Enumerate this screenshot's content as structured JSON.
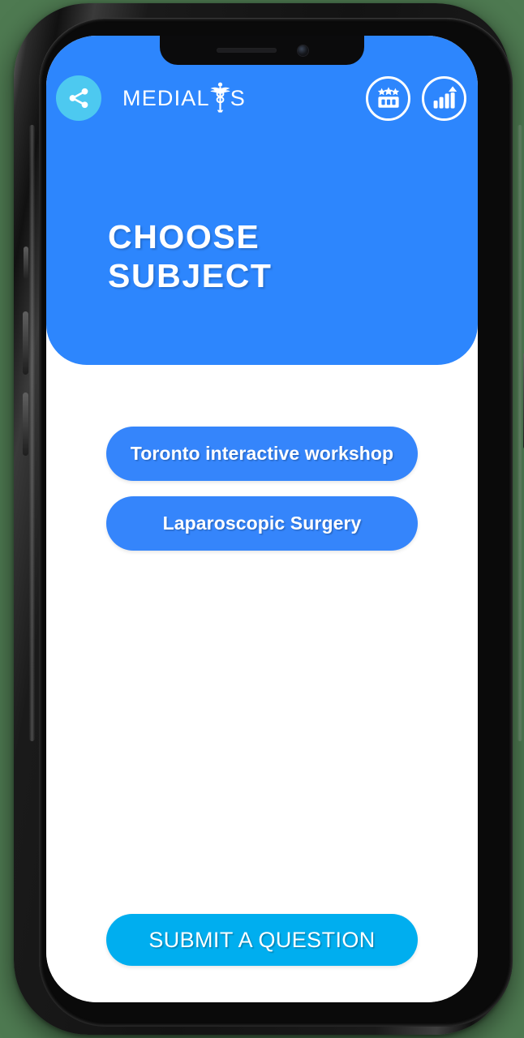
{
  "device": {
    "type": "smartphone-mockup",
    "background_color": "#4e7a51"
  },
  "theme": {
    "header_blue": "#2d86fd",
    "subject_button_blue": "#3585fb",
    "submit_cyan": "#00aeef",
    "share_circle_cyan": "#4dc9f0",
    "text_white": "#ffffff"
  },
  "header": {
    "share_button": {
      "icon": "share-icon",
      "label": "Share"
    },
    "brand": {
      "text_before": "MEDIAL",
      "symbol": "caduceus-icon",
      "text_after": "S",
      "full_name": "MEDIALIS"
    },
    "actions": [
      {
        "name": "leaderboard-button",
        "icon": "leaderboard-icon",
        "label": "Leaderboard"
      },
      {
        "name": "statistics-button",
        "icon": "growth-chart-icon",
        "label": "Statistics"
      }
    ],
    "title": "CHOOSE\nSUBJECT"
  },
  "main": {
    "subjects": [
      {
        "label": "Toronto interactive workshop"
      },
      {
        "label": "Laparoscopic Surgery"
      }
    ]
  },
  "footer": {
    "submit_label": "SUBMIT A QUESTION"
  }
}
